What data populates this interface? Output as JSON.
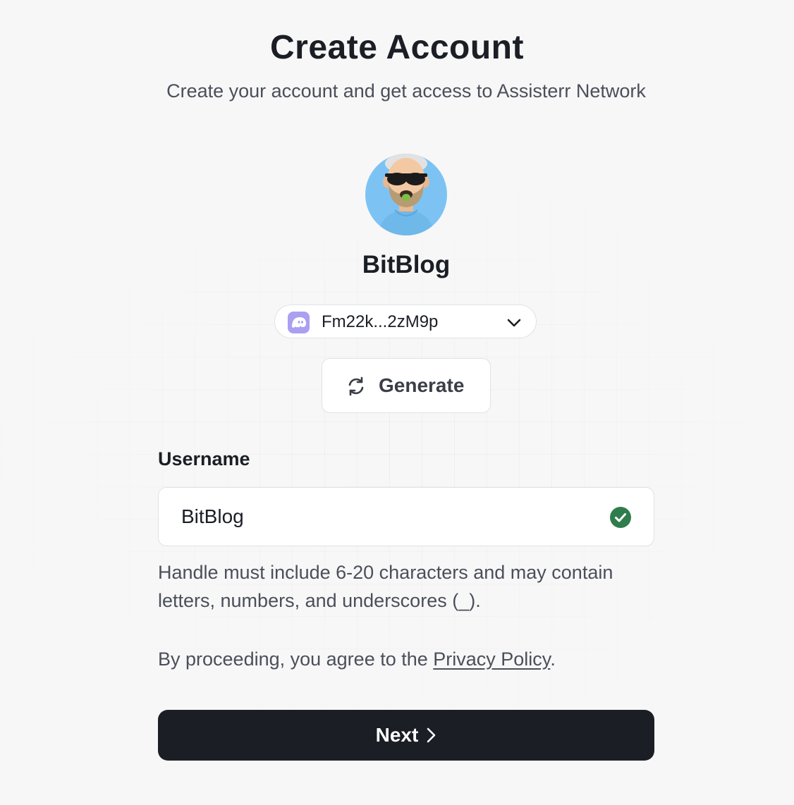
{
  "header": {
    "title": "Create Account",
    "subtitle": "Create your account and get access to Assisterr Network"
  },
  "profile": {
    "display_name": "BitBlog",
    "avatar_background": "#7cc3f4"
  },
  "wallet": {
    "address": "Fm22k...2zM9p",
    "wallet_icon": "phantom-ghost-icon",
    "wallet_icon_color": "#ab9ff2",
    "dropdown_icon": "chevron-down-icon"
  },
  "generate": {
    "label": "Generate",
    "icon": "refresh-icon"
  },
  "username": {
    "label": "Username",
    "value": "BitBlog",
    "valid_icon": "check-circle-icon",
    "valid_color": "#2f7d4c",
    "hint": "Handle must include 6-20 characters and may contain letters, numbers, and underscores (_)."
  },
  "terms": {
    "prefix": "By proceeding, you agree to the ",
    "link": "Privacy Policy",
    "suffix": "."
  },
  "next": {
    "label": "Next",
    "icon": "chevron-right-icon",
    "background": "#1b1e25"
  }
}
